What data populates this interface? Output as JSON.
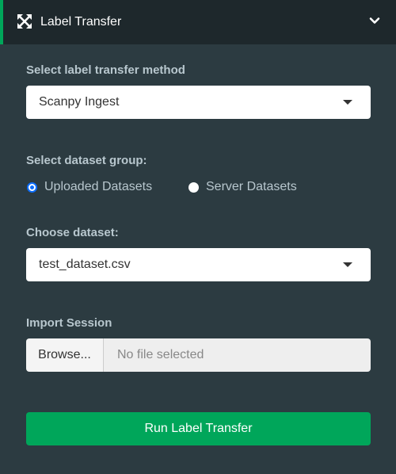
{
  "header": {
    "title": "Label Transfer",
    "icon": "expand-arrows-icon",
    "collapse_icon": "chevron-down-icon",
    "accent_color": "#00a65a"
  },
  "method": {
    "label": "Select label transfer method",
    "selected": "Scanpy Ingest"
  },
  "dataset_group": {
    "label": "Select dataset group:",
    "options": [
      {
        "label": "Uploaded Datasets",
        "checked": true
      },
      {
        "label": "Server Datasets",
        "checked": false
      }
    ]
  },
  "dataset": {
    "label": "Choose dataset:",
    "selected": "test_dataset.csv"
  },
  "import_session": {
    "label": "Import Session",
    "browse_label": "Browse...",
    "placeholder": "No file selected"
  },
  "run_button": {
    "label": "Run Label Transfer",
    "color": "#00a65a"
  }
}
